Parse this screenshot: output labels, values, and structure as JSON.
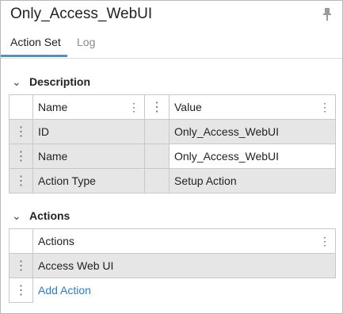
{
  "panel": {
    "title": "Only_Access_WebUI",
    "pin_icon": "pin-icon"
  },
  "tabs": [
    {
      "label": "Action Set",
      "active": true
    },
    {
      "label": "Log",
      "active": false
    }
  ],
  "description": {
    "header": "Description",
    "columns": [
      "Name",
      "Value"
    ],
    "rows": [
      {
        "name": "ID",
        "value": "Only_Access_WebUI"
      },
      {
        "name": "Name",
        "value": "Only_Access_WebUI"
      },
      {
        "name": "Action Type",
        "value": "Setup Action"
      }
    ]
  },
  "actions": {
    "header": "Actions",
    "column": "Actions",
    "rows": [
      {
        "value": "Access Web UI"
      }
    ],
    "add_label": "Add Action"
  }
}
